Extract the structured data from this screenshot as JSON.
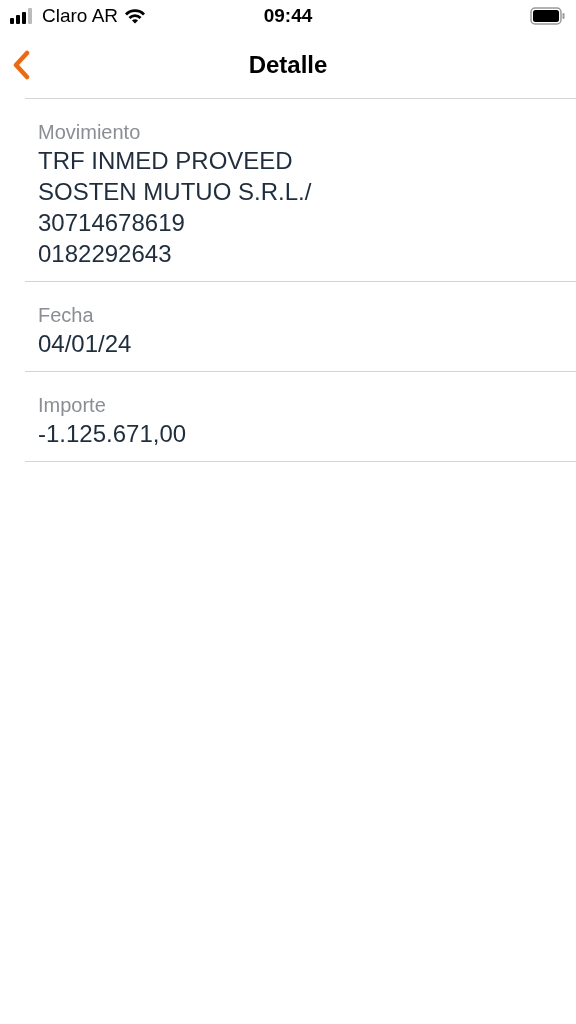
{
  "status_bar": {
    "carrier": "Claro AR",
    "time": "09:44"
  },
  "nav": {
    "title": "Detalle"
  },
  "fields": [
    {
      "label": "Movimiento",
      "lines": [
        "TRF INMED PROVEED",
        "SOSTEN MUTUO S.R.L./",
        "30714678619",
        "0182292643"
      ]
    },
    {
      "label": "Fecha",
      "lines": [
        "04/01/24"
      ]
    },
    {
      "label": "Importe",
      "lines": [
        "-1.125.671,00"
      ]
    }
  ]
}
